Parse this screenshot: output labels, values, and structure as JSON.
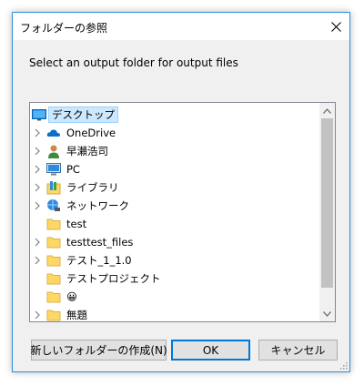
{
  "window": {
    "title": "フォルダーの参照"
  },
  "prompt": "Select an output folder for output files",
  "tree": {
    "items": [
      {
        "label": "デスクトップ",
        "icon": "desktop-icon",
        "selected": true
      },
      {
        "label": "OneDrive",
        "icon": "onedrive-cloud-icon"
      },
      {
        "label": "早瀬浩司",
        "icon": "user-icon"
      },
      {
        "label": "PC",
        "icon": "pc-icon"
      },
      {
        "label": "ライブラリ",
        "icon": "library-icon"
      },
      {
        "label": "ネットワーク",
        "icon": "network-icon"
      },
      {
        "label": "test",
        "icon": "folder-icon"
      },
      {
        "label": "testtest_files",
        "icon": "folder-icon"
      },
      {
        "label": "テスト_1_1.0",
        "icon": "folder-icon"
      },
      {
        "label": "テストプロジェクト",
        "icon": "folder-icon"
      },
      {
        "label": "😀",
        "icon": "folder-icon"
      },
      {
        "label": "無題",
        "icon": "folder-icon"
      }
    ]
  },
  "buttons": {
    "new_folder": "新しいフォルダーの作成(N)",
    "ok": "OK",
    "cancel": "キャンセル"
  },
  "colors": {
    "selection_bg": "#cce8ff",
    "selection_border": "#99d1ff",
    "default_button_border": "#0078d7",
    "window_border": "#2f8cd6",
    "folder_yellow": "#ffd764"
  }
}
